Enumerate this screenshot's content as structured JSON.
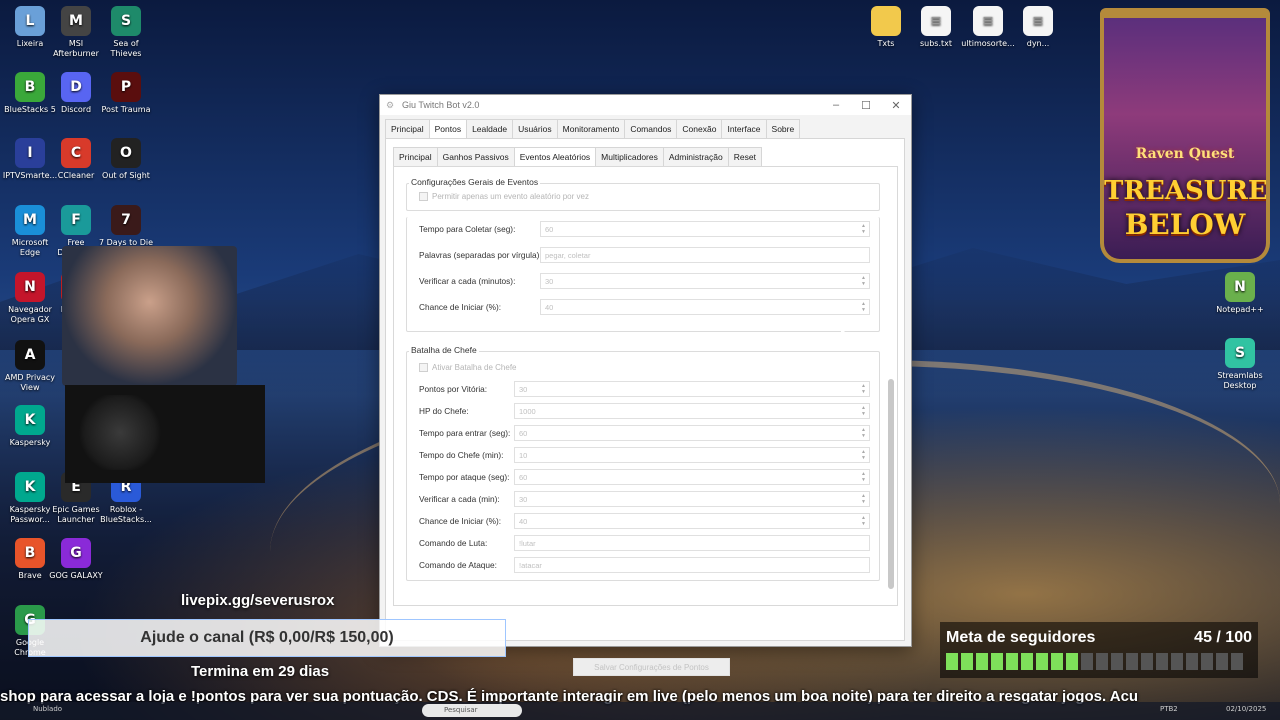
{
  "desktop": {
    "icons_left": [
      {
        "label": "Lixeira",
        "icon": "recycle-bin-icon",
        "color": "#6aa0d8"
      },
      {
        "label": "MSI Afterburner",
        "icon": "msi-afterburner-icon",
        "color": "#444444"
      },
      {
        "label": "Sea of Thieves",
        "icon": "sea-of-thieves-icon",
        "color": "#1e8a6a"
      },
      {
        "label": "BlueStacks 5",
        "icon": "bluestacks-icon",
        "color": "#3aa83a"
      },
      {
        "label": "Discord",
        "icon": "discord-icon",
        "color": "#5865f2"
      },
      {
        "label": "Post Trauma",
        "icon": "post-trauma-icon",
        "color": "#5a0e0e"
      },
      {
        "label": "IPTVSmarte...",
        "icon": "iptv-icon",
        "color": "#2a3f9a"
      },
      {
        "label": "CCleaner",
        "icon": "ccleaner-icon",
        "color": "#d83a2a"
      },
      {
        "label": "Out of Sight",
        "icon": "out-of-sight-icon",
        "color": "#222222"
      },
      {
        "label": "Microsoft Edge",
        "icon": "edge-icon",
        "color": "#1a8fd8"
      },
      {
        "label": "Free Downlo...",
        "icon": "free-download-icon",
        "color": "#1a9a9a"
      },
      {
        "label": "7 Days to Die",
        "icon": "seven-days-icon",
        "color": "#3a1a1a"
      },
      {
        "label": "Navegador Opera GX",
        "icon": "opera-gx-icon",
        "color": "#c4152b"
      },
      {
        "label": "FileZilla Client",
        "icon": "filezilla-icon",
        "color": "#bf1e1e"
      },
      {
        "label": "AMD Privacy View",
        "icon": "amd-privacy-icon",
        "color": "#111111"
      },
      {
        "label": "Kaspersky",
        "icon": "kaspersky-icon",
        "color": "#00a88e"
      },
      {
        "label": "Kaspersky Passwor...",
        "icon": "kaspersky-password-icon",
        "color": "#00a88e"
      },
      {
        "label": "Epic Games Launcher",
        "icon": "epic-games-icon",
        "color": "#2a2a2a"
      },
      {
        "label": "Roblox - BlueStacks...",
        "icon": "roblox-icon",
        "color": "#2a5ad8"
      },
      {
        "label": "Brave",
        "icon": "brave-icon",
        "color": "#e8542a"
      },
      {
        "label": "GOG GALAXY",
        "icon": "gog-galaxy-icon",
        "color": "#8a2ad8"
      },
      {
        "label": "Google Chrome",
        "icon": "chrome-icon",
        "color": "#2a9a4a"
      }
    ],
    "icons_top": [
      {
        "label": "Txts",
        "icon": "folder-icon"
      },
      {
        "label": "subs.txt",
        "icon": "text-file-icon"
      },
      {
        "label": "ultimosorte...",
        "icon": "text-file-icon"
      },
      {
        "label": "dyn...",
        "icon": "text-file-icon"
      }
    ],
    "icons_right": [
      {
        "label": "Notepad++",
        "icon": "notepad-plus-icon"
      },
      {
        "label": "Streamlabs Desktop",
        "icon": "streamlabs-icon"
      }
    ]
  },
  "banner": {
    "subtitle": "Raven Quest",
    "title_line1": "TREASURES",
    "title_line2": "BELOW"
  },
  "window": {
    "title": "Giu Twitch Bot v2.0",
    "main_tabs": [
      "Principal",
      "Pontos",
      "Lealdade",
      "Usuários",
      "Monitoramento",
      "Comandos",
      "Conexão",
      "Interface",
      "Sobre"
    ],
    "main_active": "Pontos",
    "sub_tabs": [
      "Principal",
      "Ganhos Passivos",
      "Eventos Aleatórios",
      "Multiplicadores",
      "Administração",
      "Reset"
    ],
    "sub_active": "Eventos Aleatórios",
    "general": {
      "title": "Configurações Gerais de Eventos",
      "checkbox_label": "Permitir apenas um evento aleatório por vez"
    },
    "collect": {
      "fields": [
        {
          "label": "Tempo para Coletar (seg):",
          "value": "60",
          "type": "spin"
        },
        {
          "label": "Palavras (separadas por vírgula):",
          "value": "pegar, coletar",
          "type": "text"
        },
        {
          "label": "Verificar a cada (minutos):",
          "value": "30",
          "type": "spin"
        },
        {
          "label": "Chance de Iniciar (%):",
          "value": "40",
          "type": "spin"
        }
      ]
    },
    "boss": {
      "title": "Batalha de Chefe",
      "checkbox_label": "Ativar Batalha de Chefe",
      "fields": [
        {
          "label": "Pontos por Vitória:",
          "value": "30",
          "type": "spin"
        },
        {
          "label": "HP do Chefe:",
          "value": "1000",
          "type": "spin"
        },
        {
          "label": "Tempo para entrar (seg):",
          "value": "60",
          "type": "spin"
        },
        {
          "label": "Tempo do Chefe (min):",
          "value": "10",
          "type": "spin"
        },
        {
          "label": "Tempo por ataque (seg):",
          "value": "60",
          "type": "spin"
        },
        {
          "label": "Verificar a cada (min):",
          "value": "30",
          "type": "spin"
        },
        {
          "label": "Chance de Iniciar (%):",
          "value": "40",
          "type": "spin"
        },
        {
          "label": "Comando de Luta:",
          "value": "!lutar",
          "type": "text"
        },
        {
          "label": "Comando de Ataque:",
          "value": "!atacar",
          "type": "text"
        }
      ]
    },
    "save_label": "Salvar Configurações de Pontos"
  },
  "overlay": {
    "livepix": "livepix.gg/severusrox",
    "goal": "Ajude o canal (R$ 0,00/R$ 150,00)",
    "ends": "Termina em 29 dias",
    "follow_title": "Meta de seguidores",
    "follow_count": "45 / 100",
    "follow_progress": 0.45,
    "ticker": "shop para acessar a loja e !pontos para ver sua pontuação. CDS. É importante interagir em live (pelo menos um boa noite) para ter direito a resgatar jogos. Acu"
  },
  "taskbar": {
    "weather": "Nublado",
    "search_placeholder": "Pesquisar",
    "lang": "PTB2",
    "date": "02/10/2025"
  },
  "colors": {
    "follow_fill": "#7ee05a",
    "window_bg": "#f3f3f3"
  }
}
